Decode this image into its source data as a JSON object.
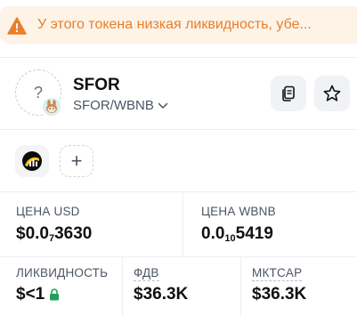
{
  "warning": {
    "text": "У этого токена низкая ликвидность, убе...",
    "icon": "warning-triangle-icon",
    "color": "#e97f2a"
  },
  "token": {
    "symbol": "SFOR",
    "pair": "SFOR/WBNB",
    "logo_placeholder": "?",
    "dex_badge_icon": "pancakeswap-icon"
  },
  "actions": {
    "copy_icon": "copy-icon",
    "favorite_icon": "star-icon"
  },
  "chips": {
    "add_label": "+"
  },
  "stats": {
    "price_usd": {
      "label": "ЦЕНА USD",
      "prefix": "$0.0",
      "subscript": "7",
      "suffix": "3630"
    },
    "price_wbnb": {
      "label": "ЦЕНА WBNB",
      "prefix": "0.0",
      "subscript": "10",
      "suffix": "5419"
    },
    "liquidity": {
      "label": "ЛИКВИДНОСТЬ",
      "value": "$<1"
    },
    "fdv": {
      "label": "ФДВ",
      "value": "$36.3K"
    },
    "mktcap": {
      "label": "МКТCAP",
      "value": "$36.3K"
    }
  }
}
